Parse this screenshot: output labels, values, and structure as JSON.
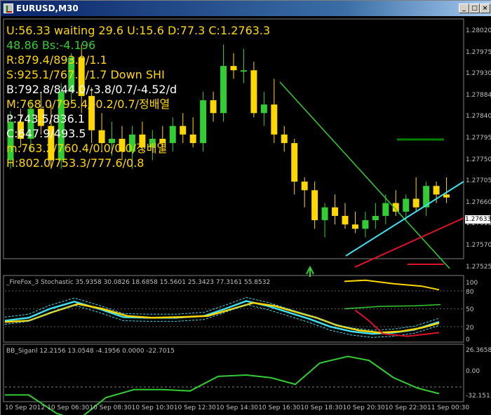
{
  "window": {
    "title": "EURUSD,M30",
    "buttons": [
      "_",
      "□",
      "×"
    ]
  },
  "overlay_text": [
    {
      "text": "U:56.33  waiting  29.6  U:15.6  D:77.3  C:1.2763.3",
      "color": "#ffd700"
    },
    {
      "text": "48.86  Bs:-4.196",
      "color": "#32cd32"
    },
    {
      "text": "R:879.4/893.9/1.1",
      "color": "#ffd700"
    },
    {
      "text": "S:925.1/767.2/1.7 Down SHI",
      "color": "#ffd700"
    },
    {
      "text": "B:792.8/844.0/-3.8/0.7/-4.52/d",
      "color": "#ffffff"
    },
    {
      "text": "M:768.0/795.4/-0.2/0.7/정배열",
      "color": "#ffd700"
    },
    {
      "text": "P:743.5/836.1",
      "color": "#ffffff"
    },
    {
      "text": "C:647.9/493.5",
      "color": "#ffffff"
    },
    {
      "text": "m:763.2/760.4/0.0/0.0/정배열",
      "color": "#ffd700"
    },
    {
      "text": "H:802.0/753.3/777.6/0.8",
      "color": "#ffd700"
    }
  ],
  "subwindow1_label": "_FireFox_3 Stochastic 35.9358 30.0826 18.6858 15.5601 25.3423 77.3161 55.8532",
  "subwindow2_label": "BB_Siganl 12.2156 13.0548 -4.1956 0.0000 -22.7015",
  "current_price": "1.27633",
  "price_axis": [
    "1.28020",
    "1.27975",
    "1.27930",
    "1.27884",
    "1.27840",
    "1.27795",
    "1.27750",
    "1.27705",
    "1.27660",
    "1.27615",
    "1.27570",
    "1.27525"
  ],
  "stoch_axis": [
    "100",
    "80",
    "50",
    "20",
    "0"
  ],
  "bb_axis": [
    "26.3658",
    "0.00",
    "-32.1513"
  ],
  "time_axis": [
    "10 Sep 2012",
    "10 Sep 06:30",
    "10 Sep 08:30",
    "10 Sep 10:30",
    "10 Sep 12:30",
    "10 Sep 14:30",
    "10 Sep 16:30",
    "10 Sep 18:30",
    "10 Sep 20:30",
    "10 Sep 22:30",
    "11 Sep 00:30"
  ],
  "colors": {
    "bull": "#32cd32",
    "bear": "#ffd700",
    "trend_green": "#32cd32",
    "trend_cyan": "#40e0f0",
    "trend_red": "#dc1428",
    "stoch_main": "#40e0f0",
    "stoch_signal": "#ffd700"
  },
  "chart_data": {
    "type": "candlestick",
    "price_range": [
      1.275,
      1.2804
    ],
    "candles": [
      [
        1.2772,
        1.27835,
        1.277,
        1.2781
      ],
      [
        1.2781,
        1.2784,
        1.2775,
        1.2777
      ],
      [
        1.2777,
        1.2786,
        1.2774,
        1.2784
      ],
      [
        1.2784,
        1.2788,
        1.2778,
        1.278
      ],
      [
        1.278,
        1.2785,
        1.277,
        1.2772
      ],
      [
        1.2772,
        1.279,
        1.277,
        1.2788
      ],
      [
        1.2788,
        1.2797,
        1.2785,
        1.2796
      ],
      [
        1.2796,
        1.2799,
        1.2783,
        1.2787
      ],
      [
        1.2787,
        1.2789,
        1.2776,
        1.2779
      ],
      [
        1.2779,
        1.2783,
        1.2774,
        1.2776
      ],
      [
        1.2776,
        1.2781,
        1.2773,
        1.2777
      ],
      [
        1.2777,
        1.278,
        1.2772,
        1.2774
      ],
      [
        1.2774,
        1.278,
        1.277,
        1.2778
      ],
      [
        1.2778,
        1.2781,
        1.2774,
        1.2775
      ],
      [
        1.2775,
        1.2779,
        1.2772,
        1.2777
      ],
      [
        1.2777,
        1.278,
        1.2774,
        1.2776
      ],
      [
        1.2776,
        1.2782,
        1.2774,
        1.278
      ],
      [
        1.278,
        1.2783,
        1.2776,
        1.2778
      ],
      [
        1.2778,
        1.2782,
        1.2775,
        1.2776
      ],
      [
        1.2776,
        1.2788,
        1.2774,
        1.2786
      ],
      [
        1.2786,
        1.2788,
        1.2781,
        1.2783
      ],
      [
        1.2783,
        1.2799,
        1.2781,
        1.2794
      ],
      [
        1.2794,
        1.2797,
        1.2791,
        1.2793
      ],
      [
        1.2793,
        1.2798,
        1.279,
        1.2793
      ],
      [
        1.2793,
        1.2795,
        1.2782,
        1.2783
      ],
      [
        1.2783,
        1.2788,
        1.278,
        1.2785
      ],
      [
        1.2785,
        1.2791,
        1.2776,
        1.2778
      ],
      [
        1.2778,
        1.278,
        1.2774,
        1.2776
      ],
      [
        1.2776,
        1.2777,
        1.2764,
        1.2767
      ],
      [
        1.2767,
        1.2768,
        1.2761,
        1.2765
      ],
      [
        1.2765,
        1.2767,
        1.2756,
        1.2758
      ],
      [
        1.2758,
        1.2762,
        1.2754,
        1.2761
      ],
      [
        1.2761,
        1.2764,
        1.2757,
        1.2759
      ],
      [
        1.2759,
        1.2762,
        1.2756,
        1.2757
      ],
      [
        1.2757,
        1.276,
        1.2755,
        1.2756
      ],
      [
        1.2756,
        1.276,
        1.2754,
        1.2758
      ],
      [
        1.2758,
        1.2762,
        1.2756,
        1.2759
      ],
      [
        1.2759,
        1.2764,
        1.2757,
        1.2762
      ],
      [
        1.2762,
        1.2765,
        1.2759,
        1.276
      ],
      [
        1.276,
        1.2764,
        1.2758,
        1.2763
      ],
      [
        1.2763,
        1.2768,
        1.276,
        1.2761
      ],
      [
        1.2761,
        1.2767,
        1.2759,
        1.2766
      ],
      [
        1.2766,
        1.2767,
        1.2762,
        1.2764
      ],
      [
        1.2764,
        1.2768,
        1.2762,
        1.27633
      ]
    ]
  }
}
